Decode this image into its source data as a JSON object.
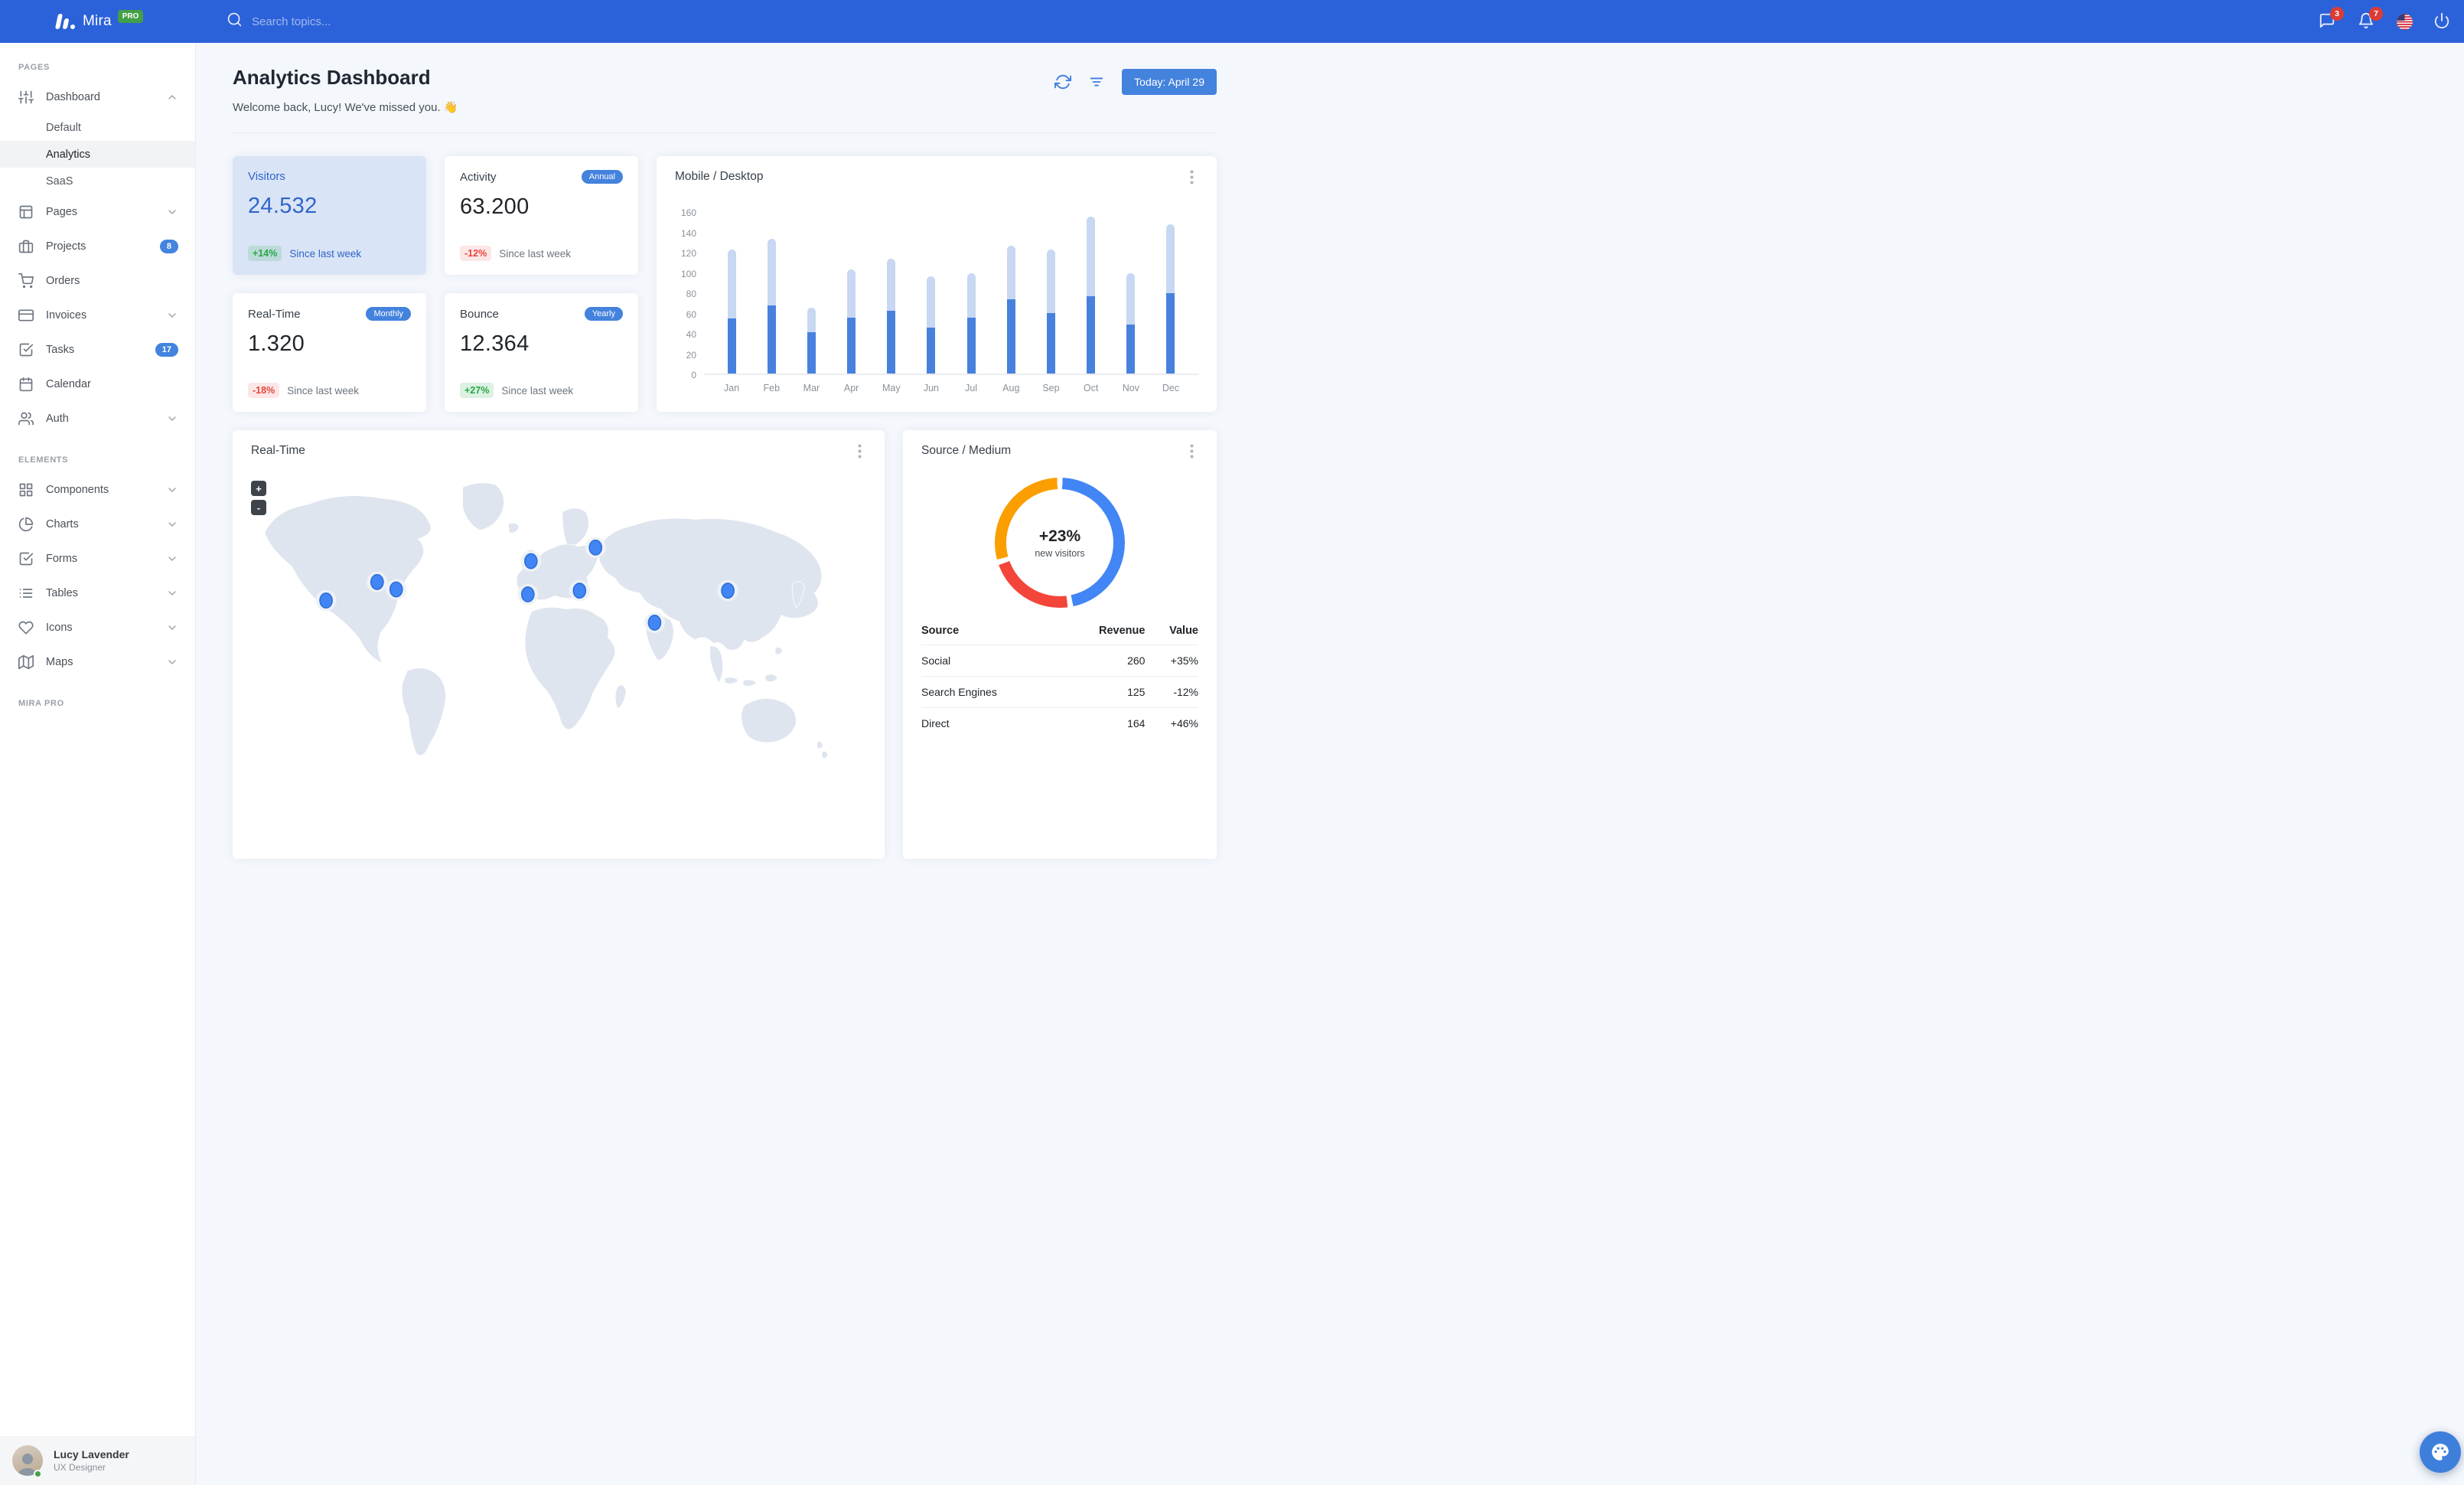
{
  "navbar": {
    "brand": "Mira",
    "brand_badge": "PRO",
    "search_placeholder": "Search topics...",
    "messages_badge": "3",
    "notifications_badge": "7"
  },
  "sidebar": {
    "sections": [
      {
        "title": "Pages",
        "items": [
          {
            "label": "Dashboard",
            "icon": "sliders",
            "chevron": "up",
            "children": [
              {
                "label": "Default",
                "active": false
              },
              {
                "label": "Analytics",
                "active": true
              },
              {
                "label": "SaaS",
                "active": false
              }
            ]
          },
          {
            "label": "Pages",
            "icon": "layout",
            "chevron": "down"
          },
          {
            "label": "Projects",
            "icon": "briefcase",
            "badge": "8"
          },
          {
            "label": "Orders",
            "icon": "shopping-cart"
          },
          {
            "label": "Invoices",
            "icon": "credit-card",
            "chevron": "down"
          },
          {
            "label": "Tasks",
            "icon": "check-square",
            "badge": "17"
          },
          {
            "label": "Calendar",
            "icon": "calendar"
          },
          {
            "label": "Auth",
            "icon": "users",
            "chevron": "down"
          }
        ]
      },
      {
        "title": "Elements",
        "items": [
          {
            "label": "Components",
            "icon": "grid",
            "chevron": "down"
          },
          {
            "label": "Charts",
            "icon": "pie-chart",
            "chevron": "down"
          },
          {
            "label": "Forms",
            "icon": "check-square",
            "chevron": "down"
          },
          {
            "label": "Tables",
            "icon": "list",
            "chevron": "down"
          },
          {
            "label": "Icons",
            "icon": "heart",
            "chevron": "down"
          },
          {
            "label": "Maps",
            "icon": "map",
            "chevron": "down"
          }
        ]
      },
      {
        "title": "Mira Pro",
        "items": []
      }
    ],
    "user": {
      "name": "Lucy Lavender",
      "role": "UX Designer"
    }
  },
  "header": {
    "title": "Analytics Dashboard",
    "subtitle": "Welcome back, Lucy! We've missed you. 👋",
    "today_button": "Today: April 29"
  },
  "stats": [
    {
      "title": "Visitors",
      "variant": "highlight",
      "badge": "",
      "value": "24.532",
      "delta": "+14%",
      "delta_dir": "up",
      "note": "Since last week"
    },
    {
      "title": "Activity",
      "variant": "",
      "badge": "Annual",
      "value": "63.200",
      "delta": "-12%",
      "delta_dir": "down",
      "note": "Since last week"
    },
    {
      "title": "Real-Time",
      "variant": "",
      "badge": "Monthly",
      "value": "1.320",
      "delta": "-18%",
      "delta_dir": "down",
      "note": "Since last week"
    },
    {
      "title": "Bounce",
      "variant": "",
      "badge": "Yearly",
      "value": "12.364",
      "delta": "+27%",
      "delta_dir": "up",
      "note": "Since last week"
    }
  ],
  "chart_data": [
    {
      "type": "bar",
      "stacked": true,
      "title": "Mobile / Desktop",
      "categories": [
        "Jan",
        "Feb",
        "Mar",
        "Apr",
        "May",
        "Jun",
        "Jul",
        "Aug",
        "Sep",
        "Oct",
        "Nov",
        "Dec"
      ],
      "series": [
        {
          "name": "Mobile",
          "color": "#4781dd",
          "values": [
            54,
            67,
            41,
            55,
            62,
            45,
            55,
            73,
            60,
            76,
            48,
            79
          ]
        },
        {
          "name": "Desktop",
          "color": "#c8d7f2",
          "values": [
            68,
            66,
            24,
            48,
            51,
            51,
            44,
            53,
            62,
            79,
            51,
            68
          ]
        }
      ],
      "xlabel": "",
      "ylabel": "",
      "ylim": [
        0,
        160
      ],
      "yticks": [
        0,
        20,
        40,
        60,
        80,
        100,
        120,
        140,
        160
      ],
      "grid": false,
      "legend": "none"
    },
    {
      "type": "donut",
      "title": "Source / Medium",
      "labels": [
        "Social",
        "Search Engines",
        "Direct"
      ],
      "values": [
        260,
        125,
        164
      ],
      "colors": [
        "#4285f4",
        "#f3453a",
        "#fb9e00"
      ],
      "center_text": "+23%",
      "center_subtext": "new visitors",
      "legend": "none"
    }
  ],
  "realtime": {
    "title": "Real-Time",
    "zoom_in": "+",
    "zoom_out": "-",
    "markers": [
      {
        "x": 122,
        "y": 222
      },
      {
        "x": 205,
        "y": 192
      },
      {
        "x": 236,
        "y": 204
      },
      {
        "x": 455,
        "y": 158
      },
      {
        "x": 450,
        "y": 212
      },
      {
        "x": 560,
        "y": 136
      },
      {
        "x": 534,
        "y": 206
      },
      {
        "x": 656,
        "y": 258
      },
      {
        "x": 775,
        "y": 206
      }
    ]
  },
  "source_medium": {
    "title": "Source / Medium",
    "headers": [
      "Source",
      "Revenue",
      "Value"
    ],
    "rows": [
      {
        "source": "Social",
        "revenue": "260",
        "value": "+35%",
        "dir": "up"
      },
      {
        "source": "Search Engines",
        "revenue": "125",
        "value": "-12%",
        "dir": "down"
      },
      {
        "source": "Direct",
        "revenue": "164",
        "value": "+46%",
        "dir": "up"
      }
    ]
  },
  "colors": {
    "navbar": "#2c62d9",
    "primary": "#4382dd",
    "success": "#28a745",
    "danger": "#e8453d",
    "highlight_card": "#d9e4f6"
  }
}
